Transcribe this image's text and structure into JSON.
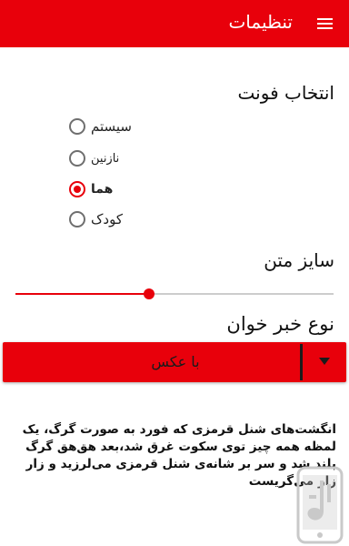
{
  "appbar": {
    "title": "تنظیمات",
    "background": "#e8000b"
  },
  "font_section": {
    "title": "انتخاب فونت",
    "options": [
      {
        "label": "سیستم",
        "checked": false
      },
      {
        "label": "نازنین",
        "checked": false
      },
      {
        "label": "هما",
        "checked": true
      },
      {
        "label": "کودک",
        "checked": false
      }
    ]
  },
  "size_section": {
    "title": "سایز متن",
    "slider_fraction": 0.42
  },
  "reader_section": {
    "title": "نوع خبر خوان",
    "selected": "با عکس"
  },
  "preview": {
    "text": "انگشت‌های شنل قرمزی که فورد به صورت گرگ، یک لمظه همه چیز توی سکوت غرق شد،بعد هق‌هق گرگ بلند شد و سر بر شانه‌ی شنل قرمزی می‌لرزید و زار زار می‌گریست"
  },
  "colors": {
    "accent": "#e8000b",
    "logo": "#c9c9c9"
  },
  "icons": {
    "menu": "hamburger-menu-icon",
    "dropdown": "triangle-down-icon",
    "logo": "app-logo-watermark"
  }
}
